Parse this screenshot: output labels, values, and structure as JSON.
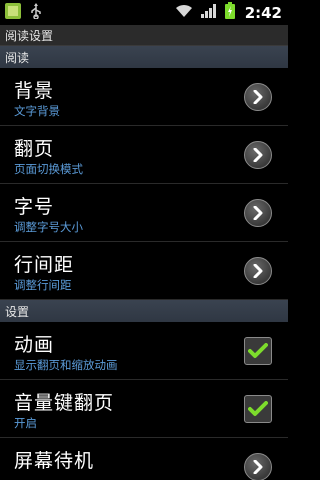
{
  "status_bar": {
    "time": "2:42",
    "icons": [
      "app-icon",
      "usb-icon",
      "wifi-icon",
      "signal-icon",
      "battery-charging-icon"
    ]
  },
  "title_bar": {
    "title": "阅读设置"
  },
  "sections": [
    {
      "header": "阅读",
      "items": [
        {
          "title": "背景",
          "summary": "文字背景",
          "control": "chevron"
        },
        {
          "title": "翻页",
          "summary": "页面切换模式",
          "control": "chevron"
        },
        {
          "title": "字号",
          "summary": "调整字号大小",
          "control": "chevron"
        },
        {
          "title": "行间距",
          "summary": "调整行间距",
          "control": "chevron"
        }
      ]
    },
    {
      "header": "设置",
      "items": [
        {
          "title": "动画",
          "summary": "显示翻页和缩放动画",
          "control": "checkbox",
          "checked": true
        },
        {
          "title": "音量键翻页",
          "summary": "开启",
          "control": "checkbox",
          "checked": true
        },
        {
          "title": "屏幕待机",
          "summary": "",
          "control": "chevron"
        }
      ]
    }
  ],
  "colors": {
    "summary": "#5b9bd8",
    "check": "#7ddc2c",
    "section_bg": "#343c48"
  }
}
